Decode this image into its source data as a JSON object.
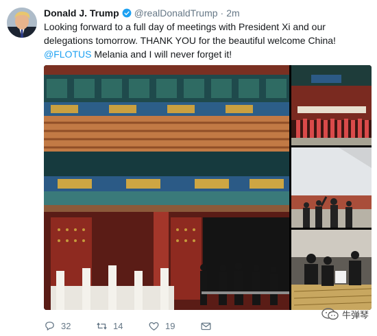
{
  "tweet": {
    "author_name": "Donald J. Trump",
    "handle": "@realDonaldTrump",
    "separator": "·",
    "time": "2m",
    "text_part1": "Looking forward to a full day of meetings with President Xi and our delegations tomorrow. THANK YOU for the beautiful welcome China! ",
    "mention": "@FLOTUS",
    "text_part2": " Melania and I will never forget it!"
  },
  "actions": {
    "reply_count": "32",
    "retweet_count": "14",
    "like_count": "19"
  },
  "icons": {
    "verified": "verified-badge-icon",
    "reply": "reply-icon",
    "retweet": "retweet-icon",
    "like": "heart-icon",
    "dm": "mail-icon"
  },
  "watermark": {
    "label": "牛弹琴"
  },
  "colors": {
    "link": "#1da1f2",
    "muted": "#657786",
    "text": "#14171a"
  }
}
